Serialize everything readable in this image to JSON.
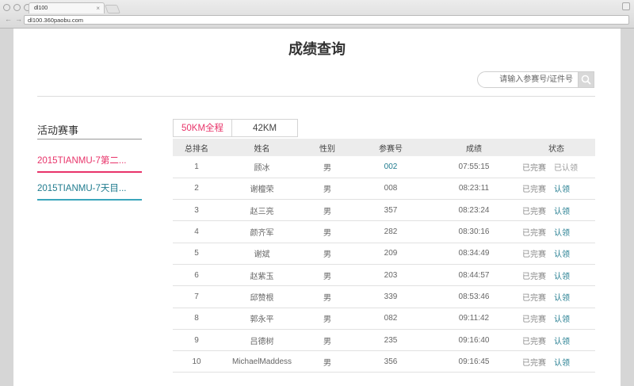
{
  "browser": {
    "tab_title": "dl100",
    "tab_close": "×",
    "back_glyph": "←",
    "forward_glyph": "→",
    "url": "dl100.360paobu.com"
  },
  "page": {
    "title": "成绩查询",
    "search_placeholder": "请输入参赛号/证件号"
  },
  "sidebar": {
    "title": "活动赛事",
    "items": [
      {
        "label": "2015TIANMU-7第二..."
      },
      {
        "label": "2015TIANMU-7天目..."
      }
    ]
  },
  "tabs": [
    {
      "label": "50KM全程"
    },
    {
      "label": "42KM"
    }
  ],
  "table": {
    "headers": [
      "总排名",
      "姓名",
      "性别",
      "参赛号",
      "成绩",
      "状态"
    ],
    "rows": [
      {
        "rank": "1",
        "name": "顾冰",
        "gender": "男",
        "bib": "002",
        "time": "07:55:15",
        "status": "已完赛",
        "action": "已认领"
      },
      {
        "rank": "2",
        "name": "谢檀荣",
        "gender": "男",
        "bib": "008",
        "time": "08:23:11",
        "status": "已完赛",
        "action": "认领"
      },
      {
        "rank": "3",
        "name": "赵三亮",
        "gender": "男",
        "bib": "357",
        "time": "08:23:24",
        "status": "已完赛",
        "action": "认领"
      },
      {
        "rank": "4",
        "name": "颜齐军",
        "gender": "男",
        "bib": "282",
        "time": "08:30:16",
        "status": "已完赛",
        "action": "认领"
      },
      {
        "rank": "5",
        "name": "谢斌",
        "gender": "男",
        "bib": "209",
        "time": "08:34:49",
        "status": "已完赛",
        "action": "认领"
      },
      {
        "rank": "6",
        "name": "赵紫玉",
        "gender": "男",
        "bib": "203",
        "time": "08:44:57",
        "status": "已完赛",
        "action": "认领"
      },
      {
        "rank": "7",
        "name": "邱赞根",
        "gender": "男",
        "bib": "339",
        "time": "08:53:46",
        "status": "已完赛",
        "action": "认领"
      },
      {
        "rank": "8",
        "name": "郭永平",
        "gender": "男",
        "bib": "082",
        "time": "09:11:42",
        "status": "已完赛",
        "action": "认领"
      },
      {
        "rank": "9",
        "name": "吕德树",
        "gender": "男",
        "bib": "235",
        "time": "09:16:40",
        "status": "已完赛",
        "action": "认领"
      },
      {
        "rank": "10",
        "name": "MichaelMaddess",
        "gender": "男",
        "bib": "356",
        "time": "09:16:45",
        "status": "已完赛",
        "action": "认领"
      }
    ]
  },
  "colors": {
    "accent_pink": "#e8346a",
    "accent_teal": "#217c8f"
  }
}
